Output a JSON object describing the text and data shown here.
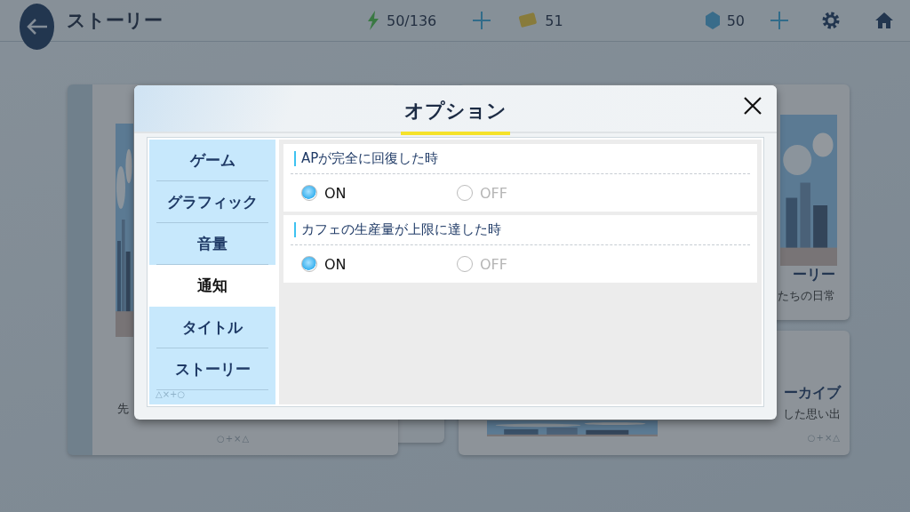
{
  "top_bar": {
    "title": "ストーリー",
    "ap": "50/136",
    "tickets": "51",
    "gems": "50"
  },
  "background_cards": [
    {
      "subtitle": "先",
      "mark": "○+×△"
    },
    {
      "title": "ーリー",
      "subtitle": "たちの日常"
    },
    {
      "title": "ーカイブ",
      "subtitle": "した思い出",
      "mark": "○+×△"
    }
  ],
  "dialog": {
    "title": "オプション",
    "tabs": [
      {
        "label": "ゲーム",
        "selected": false
      },
      {
        "label": "グラフィック",
        "selected": false
      },
      {
        "label": "音量",
        "selected": false
      },
      {
        "label": "通知",
        "selected": true
      },
      {
        "label": "タイトル",
        "selected": false
      },
      {
        "label": "ストーリー",
        "selected": false
      }
    ],
    "tabs_mark": "△×+○",
    "settings": [
      {
        "label": "APが完全に回復した時",
        "options": [
          {
            "label": "ON",
            "selected": true
          },
          {
            "label": "OFF",
            "selected": false
          }
        ]
      },
      {
        "label": "カフェの生産量が上限に達した時",
        "options": [
          {
            "label": "ON",
            "selected": true
          },
          {
            "label": "OFF",
            "selected": false
          }
        ]
      }
    ]
  }
}
